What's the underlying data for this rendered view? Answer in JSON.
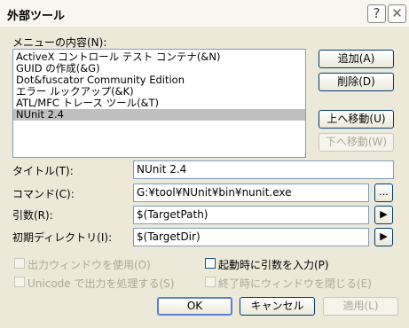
{
  "window": {
    "title": "外部ツール",
    "help_glyph": "?",
    "close_glyph": "✕"
  },
  "menu_contents_label": "メニューの内容(N):",
  "tools_list": [
    "ActiveX コントロール テスト コンテナ(&N)",
    "GUID の作成(&G)",
    "Dot&fuscator Community Edition",
    "エラー ルックアップ(&K)",
    "ATL/MFC トレース ツール(&T)",
    "NUnit 2.4"
  ],
  "selected_index": 5,
  "buttons": {
    "add": "追加(A)",
    "delete": "削除(D)",
    "move_up": "上へ移動(U)",
    "move_down": "下へ移動(W)",
    "ok": "OK",
    "cancel": "キャンセル",
    "apply": "適用(L)"
  },
  "fields": {
    "title_label": "タイトル(T):",
    "title_value": "NUnit 2.4",
    "command_label": "コマンド(C):",
    "command_value": "G:¥tool¥NUnit¥bin¥nunit.exe",
    "command_browse": "...",
    "args_label": "引数(R):",
    "args_value": "$(TargetPath)",
    "initdir_label": "初期ディレクトリ(I):",
    "initdir_value": "$(TargetDir)",
    "arrow_glyph": "▶"
  },
  "options": {
    "use_output_window": "出力ウィンドウを使用(O)",
    "prompt_for_args": "起動時に引数を入力(P)",
    "unicode_output": "Unicode で出力を処理する(S)",
    "close_on_exit": "終了時にウィンドウを閉じる(E)"
  }
}
